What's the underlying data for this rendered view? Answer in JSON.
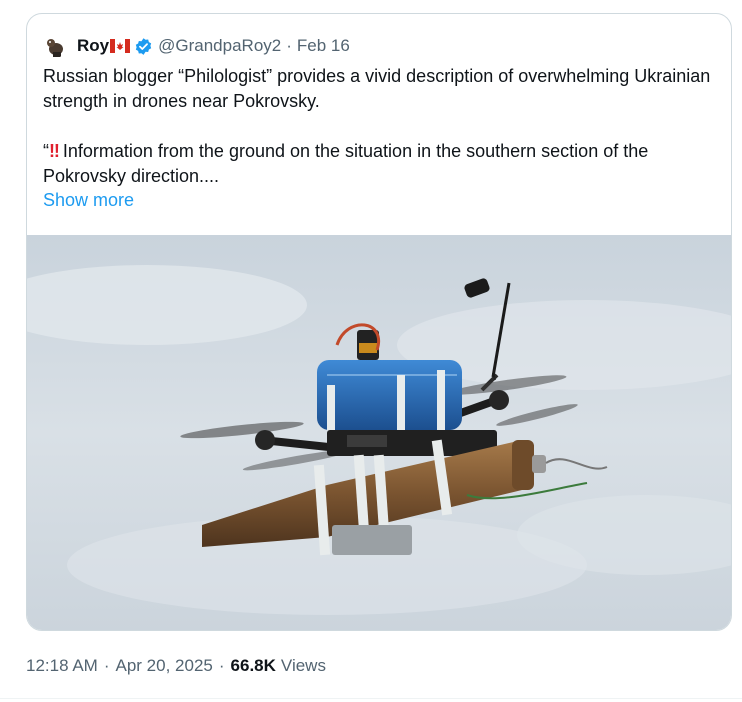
{
  "quoted_tweet": {
    "author_name": "Roy",
    "author_flag": "🇨🇦",
    "handle": "@GrandpaRoy2",
    "separator": "·",
    "date": "Feb 16",
    "text_line1": "Russian blogger “Philologist” provides a vivid description of overwhelming Ukrainian strength in drones near Pokrovsky.",
    "text_quote_open": "“",
    "text_emoji": "‼",
    "text_line2": "Information from the ground on the situation in the southern section of the Pokrovsky direction....",
    "show_more": "Show more",
    "media_subject": "FPV drone carrying a shell against a cloudy sky"
  },
  "tweet_meta": {
    "time": "12:18 AM",
    "dot1": "·",
    "date": "Apr 20, 2025",
    "dot2": "·",
    "views_count": "66.8K",
    "views_label": "Views"
  },
  "colors": {
    "link": "#1d9bf0",
    "secondary_text": "#536471",
    "border": "#cfd9de",
    "verified": "#1d9bf0"
  },
  "icons": {
    "verified": "verified-badge-icon",
    "avatar": "avatar-image"
  }
}
